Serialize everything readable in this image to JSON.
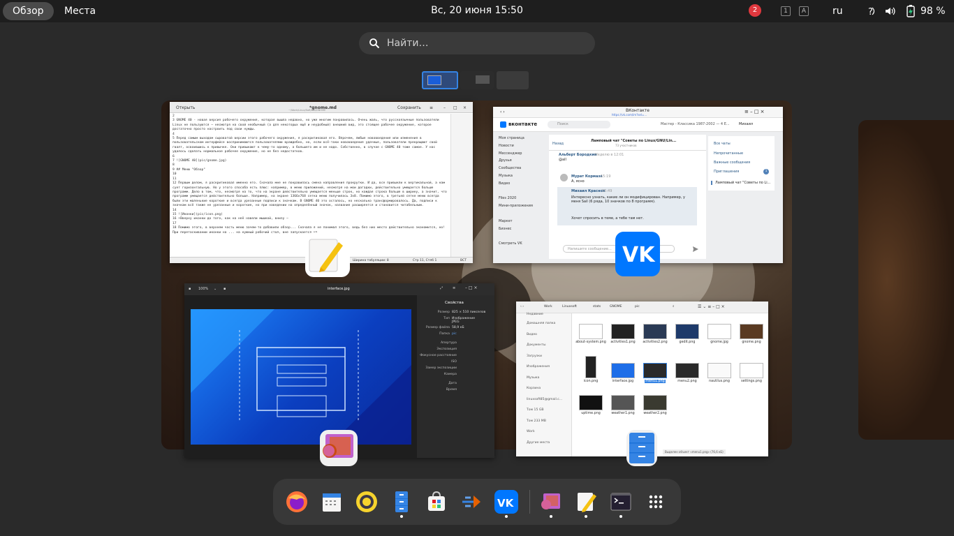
{
  "topbar": {
    "overview_label": "Обзор",
    "places_label": "Места",
    "clock": "Вс, 20 июня  15:50",
    "notification_count": "2",
    "kbd_indicator_1": "1",
    "kbd_indicator_2": "A",
    "language": "ru",
    "battery": "98 %"
  },
  "search": {
    "placeholder": "Найти…"
  },
  "editor": {
    "open_label": "Открыть",
    "title": "*gnome.md",
    "path": "~/Work/Linux/Soft/sist/GNOME",
    "save_label": "Сохранить",
    "text": "2\n3 GNOME 40 - новая версия рабочего окружения, которая вышла недавно, но уже многим понравилась. Очень жаль, что русскоязычные пользователи Linux не пользуются — несмотря на свой необычный (а для некоторых ещё и неудобный) внешний вид, это стоящее рабочее окружение, которое достаточно просто настроить под свои нужды.\n4\n5 Перед самым выходом сыроватой версии этого рабочего окружения, я раскритиковал его. Впрочем, любые нововведения или изменения в пользовательском интерфейсе воспринимаются пользователями враждебно, но, если всё-таки нововведения удачные, пользователи прекращают свой гвалт, освоившись к привычке. Они привыкают к чему-то одному, а большего им и не надо. Собственно, в случае с GNOME 40 тоже самое. У нас удалось сделать нормальное рабочее окружение, но не без недостатков.\n6\n7 ![GNOME 40](pic/gnome.jpg)\n8\n9 ## Меню \"Обзор\"\n10\n11\n12 Первым делом, я раскритиковал именно его. Сначала мне не понравилась смена направления прокрутки. И да, все привыкли к вертикальной, а нам сует горизонтальную. Но у этого способа есть плюс: например, в меню приложений, несмотря на мои догадки, действительно умещается больше программ. Дело в том, что, несмотря на то, что на экране действительно умещается меньше строк, но каждая строка больше в ширину, а значит, что программ умещается действительно больше. Например, на экране 1366x768 сетка меню получилась 3x8. Помимо этого, в третьей сетке меню всегда были эти маленькие короткие и всегда урезанные подписи к значкам. В GNOME 40 это осталось, но несколько трансформировалось. Да, подписи к значкам всё также не урезанные и короткие, но при наведении на определённый значок, название расширяется и становится читабельным.\n14\n15 ![Иконки](pic/icon.png)\n16 +Вверху иконки до того, как на неё навели мышкой, внизу —\n17\n18 Помимо этого, в верхнем часть меню зачем-то добавили обзор... Сначала я не понимал этого, ведь без них место действительно экономится, но! При перетаскивании иконки на ... на нужный рабочий стол, вне запускается на",
    "status_format": "Markdown",
    "status_tabs": "Ширина табуляции: 8",
    "status_pos": "Стр 11, Стлб 1",
    "status_mode": "ВСТ"
  },
  "vk": {
    "title": "ВКонтакте",
    "url": "https://vk.com/im?sel=...",
    "logo": "вконтакте",
    "search_placeholder": "Поиск",
    "track": "Мастер - Классика 1987-2002 — 4 Е...",
    "user": "Михаил",
    "sidebar": [
      "Моя страница",
      "Новости",
      "Мессенджер",
      "Друзья",
      "Сообщества",
      "Музыка",
      "Видео",
      "",
      "Files 2020",
      "Мини-приложения",
      "",
      "Маркет",
      "Бизнес",
      "",
      "Смотреть VK"
    ],
    "back": "Назад",
    "chat_title": "Ламповый чат \"Советы по Linux/GNU/Lin...",
    "chat_members": "73 участников",
    "msg1_author": "Альберт Бородкин",
    "msg1_time": "Неделю в 12:01",
    "msg1_text": "@all",
    "msg2_author": "Мурат Кормаза",
    "msg2_time": "15:19",
    "msg2_text": "А, ясно",
    "msg3_author": "Михаил Краснов",
    "msg3_time": "15:49",
    "msg3_text": "Интересно узнать, какие ли он модифицирован. Например, у меня Sail (6 ряда, 10 значков по 8 программ).",
    "msg4_text": "Хочет спросить в теме, а тебе там нет.",
    "input_placeholder": "Напишите сообщение...",
    "folders": [
      "Все чаты",
      "Непрочитанные",
      "Важные сообщения",
      "Приглашения"
    ],
    "folders_badge": "1",
    "folder_active": "Ламповый чат \"Советы по Li..."
  },
  "viewer": {
    "zoom": "100%",
    "title": "interface.jpg",
    "props_title": "Свойства",
    "props": [
      [
        "Размер",
        "825 × 510 пикселов"
      ],
      [
        "Тип",
        "Изображение JPEG"
      ],
      [
        "Размер файла",
        "58,9 кБ"
      ],
      [
        "Папка",
        "pic"
      ],
      [
        "Апертура",
        ""
      ],
      [
        "Экспозиция",
        ""
      ],
      [
        "Фокусное расстояние",
        ""
      ],
      [
        "ISO",
        ""
      ],
      [
        "Замер экспозиции",
        ""
      ],
      [
        "Камера",
        ""
      ],
      [
        "Дата",
        ""
      ],
      [
        "Время",
        ""
      ]
    ]
  },
  "files": {
    "breadcrumb": [
      "Work",
      "Linuxsoft",
      "stats",
      "GNOME",
      "pic"
    ],
    "sidebar": [
      "Недавние",
      "Домашняя папка",
      "Видео",
      "Документы",
      "Загрузки",
      "Изображения",
      "Музыка",
      "Корзина",
      "linuxsoft85@gmail.c...",
      "Том 15 GB",
      "Том 233 MB",
      "Work",
      "Другие места"
    ],
    "items": [
      "about-system.png",
      "activities1.png",
      "activities2.png",
      "gedit.png",
      "gnome.jpg",
      "gnome.png",
      "icon.png",
      "interface.jpg",
      "menu1.png",
      "menu2.png",
      "nautilus.png",
      "settings.png",
      "uptime.png",
      "weather1.png",
      "weather2.png"
    ],
    "selected": "menu1.png",
    "status": "Выделен объект «menu1.png» (76,6 кБ)"
  },
  "dock": {
    "items": [
      "firefox-icon",
      "calendar-icon",
      "rhythmbox-icon",
      "files-icon",
      "software-icon",
      "gitg-icon",
      "vk-icon",
      "image-viewer-icon",
      "text-editor-icon",
      "terminal-icon",
      "app-grid-icon"
    ]
  },
  "colors": {
    "accent": "#3584e4",
    "vk": "#0077ff",
    "topbar": "#1e1e1e",
    "dock": "#383838"
  }
}
